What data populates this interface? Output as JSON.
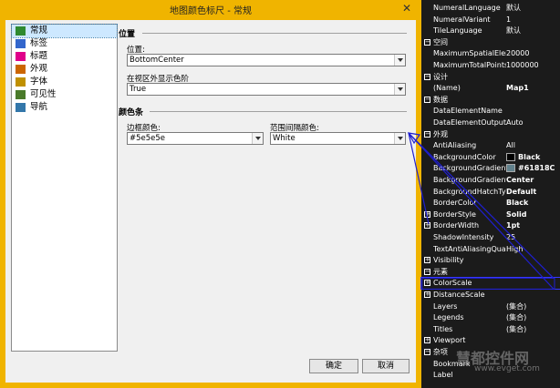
{
  "dialog": {
    "title": "地图颜色标尺 - 常规",
    "close_glyph": "✕",
    "nav": [
      {
        "label": "常规",
        "icon": "general-icon",
        "color": "#2f8a2f"
      },
      {
        "label": "标签",
        "icon": "labels-icon",
        "color": "#3366cc"
      },
      {
        "label": "标题",
        "icon": "title-icon",
        "color": "#e0008a"
      },
      {
        "label": "外观",
        "icon": "appearance-icon",
        "color": "#cc6600"
      },
      {
        "label": "字体",
        "icon": "font-icon",
        "color": "#c09000"
      },
      {
        "label": "可见性",
        "icon": "visibility-icon",
        "color": "#4a7a2a"
      },
      {
        "label": "导航",
        "icon": "navigation-icon",
        "color": "#3377aa"
      }
    ],
    "position_section": "位置",
    "position_label": "位置:",
    "position_value": "BottomCenter",
    "show_label": "在视区外显示色阶",
    "show_value": "True",
    "colorbar_section": "颜色条",
    "border_color_label": "边框颜色:",
    "border_color_value": "#5e5e5e",
    "range_gap_label": "范围间隔颜色:",
    "range_gap_value": "White",
    "ok_label": "确定",
    "cancel_label": "取消"
  },
  "properties": {
    "rows": [
      {
        "name": "NumeralLanguage",
        "value": "默认",
        "type": "prop"
      },
      {
        "name": "NumeralVariant",
        "value": "1",
        "type": "prop"
      },
      {
        "name": "TileLanguage",
        "value": "默认",
        "type": "prop"
      },
      {
        "name": "空间",
        "value": "",
        "type": "cat"
      },
      {
        "name": "MaximumSpatialElements",
        "value": "20000",
        "type": "prop"
      },
      {
        "name": "MaximumTotalPoints",
        "value": "1000000",
        "type": "prop"
      },
      {
        "name": "设计",
        "value": "",
        "type": "cat"
      },
      {
        "name": "(Name)",
        "value": "Map1",
        "type": "propb"
      },
      {
        "name": "数据",
        "value": "",
        "type": "cat"
      },
      {
        "name": "DataElementName",
        "value": "",
        "type": "prop"
      },
      {
        "name": "DataElementOutput",
        "value": "Auto",
        "type": "prop"
      },
      {
        "name": "外观",
        "value": "",
        "type": "cat"
      },
      {
        "name": "AntiAliasing",
        "value": "All",
        "type": "prop"
      },
      {
        "name": "BackgroundColor",
        "value": "Black",
        "type": "swatch",
        "swatch": "#000000"
      },
      {
        "name": "BackgroundGradientEndColor",
        "value": "#61818C",
        "type": "swatch",
        "swatch": "#61818c"
      },
      {
        "name": "BackgroundGradientType",
        "value": "Center",
        "type": "propb"
      },
      {
        "name": "BackgroundHatchType",
        "value": "Default",
        "type": "propb"
      },
      {
        "name": "BorderColor",
        "value": "Black",
        "type": "propb"
      },
      {
        "name": "BorderStyle",
        "value": "Solid",
        "type": "propbexp"
      },
      {
        "name": "BorderWidth",
        "value": "1pt",
        "type": "propbexp"
      },
      {
        "name": "ShadowIntensity",
        "value": "25",
        "type": "prop"
      },
      {
        "name": "TextAntiAliasingQuality",
        "value": "High",
        "type": "prop"
      },
      {
        "name": "Visibility",
        "value": "",
        "type": "propexp"
      },
      {
        "name": "元素",
        "value": "",
        "type": "cat"
      },
      {
        "name": "ColorScale",
        "value": "",
        "type": "propexpsel"
      },
      {
        "name": "DistanceScale",
        "value": "",
        "type": "propexp"
      },
      {
        "name": "Layers",
        "value": "(集合)",
        "type": "prop"
      },
      {
        "name": "Legends",
        "value": "(集合)",
        "type": "prop"
      },
      {
        "name": "Titles",
        "value": "(集合)",
        "type": "prop"
      },
      {
        "name": "Viewport",
        "value": "",
        "type": "propexp"
      },
      {
        "name": "杂项",
        "value": "",
        "type": "cat"
      },
      {
        "name": "Bookmark",
        "value": "",
        "type": "prop"
      },
      {
        "name": "Label",
        "value": "",
        "type": "prop"
      }
    ]
  },
  "watermark": {
    "main": "慧都控件网",
    "sub": "www.evget.com"
  },
  "annotation": {
    "color": "#1f1fd0"
  }
}
